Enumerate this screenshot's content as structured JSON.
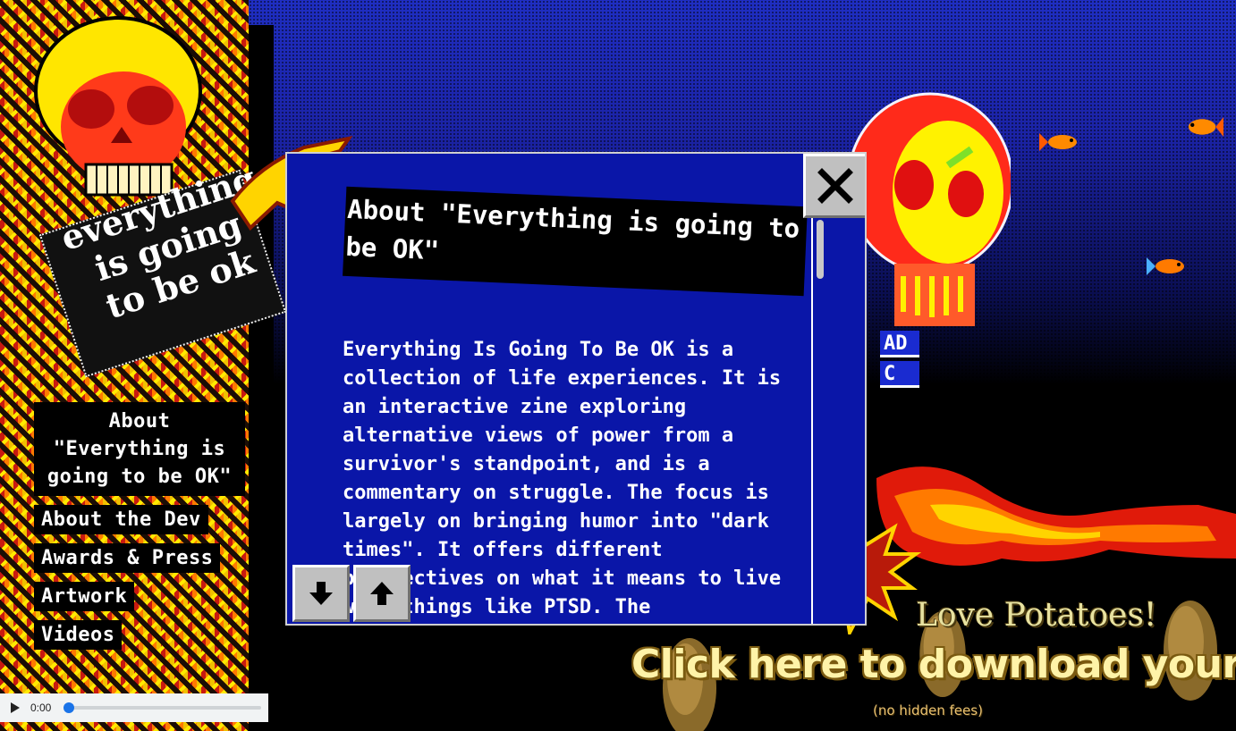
{
  "tagline": "everything is going to be ok",
  "nav": {
    "items": [
      "About \"Everything is going to be OK\"",
      "About the Dev",
      "Awards & Press",
      "Artwork",
      "Videos"
    ]
  },
  "audio": {
    "time": "0:00",
    "progress": 0
  },
  "dialog": {
    "title": "About \"Everything is going to be OK\"",
    "body": "Everything Is Going To Be OK is a collection of life experiences. It is an interactive zine exploring alternative views of power from a survivor's standpoint, and is a commentary on struggle. The focus is largely on bringing humor into \"dark times\". It offers different perspectives on what it means to live with things like PTSD. The",
    "close_icon": "close-x-icon",
    "down_icon": "arrow-down-icon",
    "up_icon": "arrow-up-icon"
  },
  "behind_window": {
    "line1": "AD",
    "line2": "C"
  },
  "ad": {
    "love": "Love Potatoes!",
    "cta": "Click here to download yours!",
    "note": "(no hidden fees)"
  },
  "colors": {
    "dialog_bg": "#0a16a8",
    "button_grey": "#c0c0c0",
    "ad_text": "#fff3a8"
  }
}
